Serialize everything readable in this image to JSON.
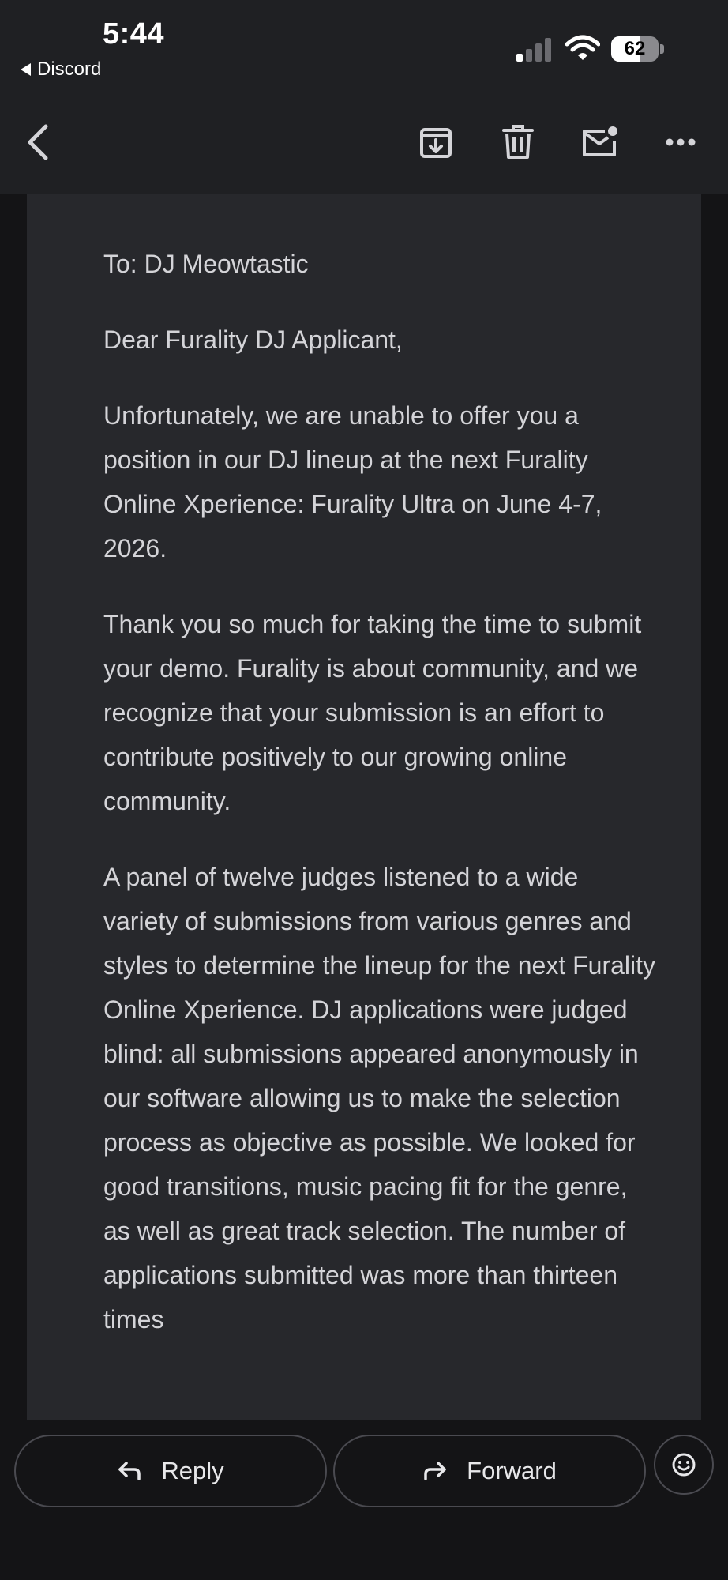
{
  "status_bar": {
    "time": "5:44",
    "back_app": "Discord",
    "battery": "62",
    "battery_level": 0.62
  },
  "toolbar": {
    "icons": [
      "back-chevron-icon",
      "archive-icon",
      "trash-icon",
      "mark-unread-icon",
      "more-icon"
    ]
  },
  "email": {
    "to_line": "To: DJ Meowtastic",
    "greeting": "Dear Furality DJ Applicant,",
    "paragraphs": [
      "Unfortunately, we are unable to offer you a position in our DJ lineup at the next Furality Online Xperience: Furality Ultra on June 4-7, 2026.",
      "Thank you so much for taking the time to submit your demo. Furality is about community, and we recognize that your submission is an effort to contribute positively to our growing online community.",
      "A panel of twelve judges listened to a wide variety of submissions from various genres and styles to determine the lineup for the next Furality Online Xperience. DJ applications were judged blind: all submissions appeared anonymously in our software allowing us to make the selection process as objective as possible. We looked for good transitions, music pacing fit for the genre, as well as great track selection. The number of applications submitted was more than thirteen times"
    ]
  },
  "actions": {
    "reply_label": "Reply",
    "forward_label": "Forward"
  },
  "colors": {
    "background": "#141416",
    "toolbar": "#1f2023",
    "card": "#27282c",
    "text": "#d4d4d8"
  }
}
